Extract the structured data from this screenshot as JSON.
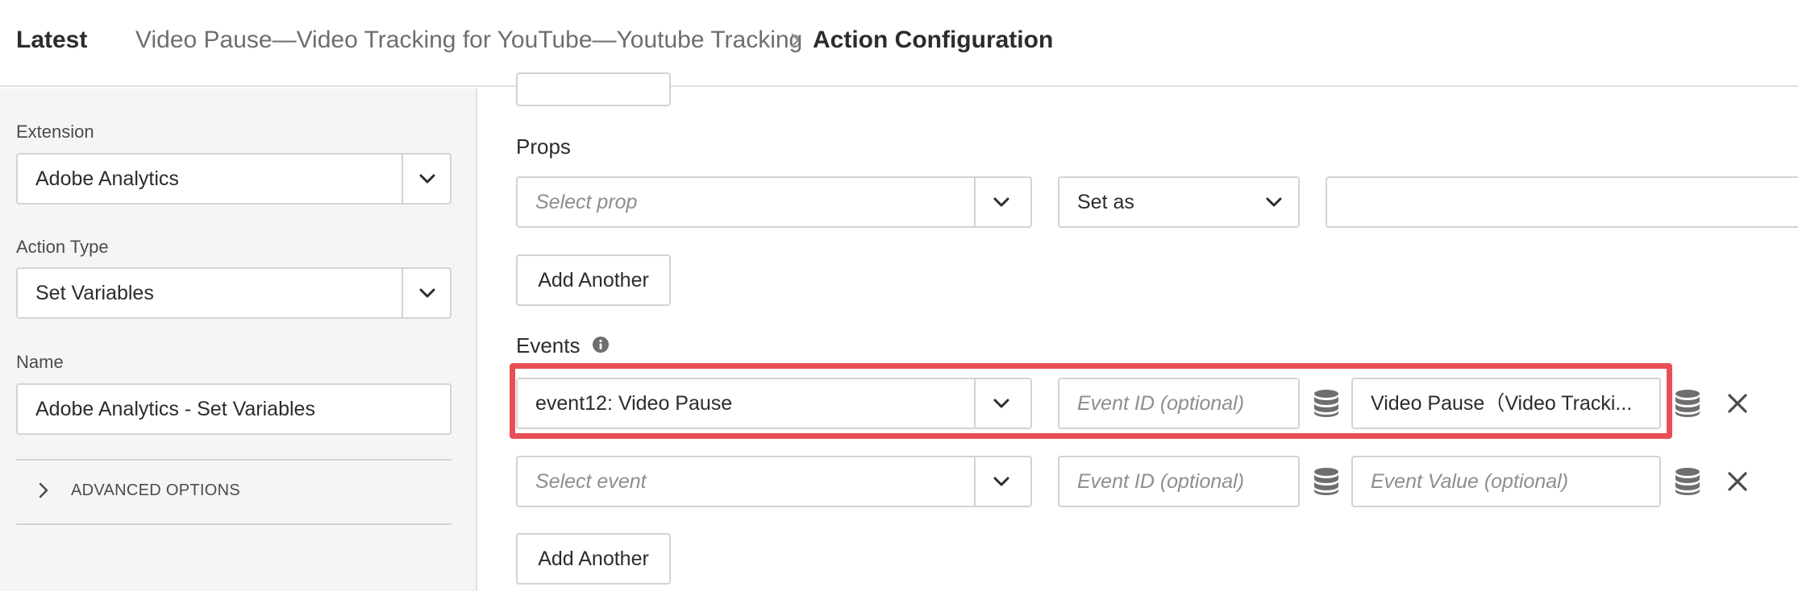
{
  "header": {
    "version_label": "Latest",
    "breadcrumb": "Video Pause—Video Tracking for YouTube—Youtube Tracking",
    "current_page": "Action Configuration"
  },
  "sidebar": {
    "extension": {
      "label": "Extension",
      "value": "Adobe Analytics"
    },
    "action_type": {
      "label": "Action Type",
      "value": "Set Variables"
    },
    "name": {
      "label": "Name",
      "value": "Adobe Analytics - Set Variables"
    },
    "advanced_options_label": "ADVANCED OPTIONS"
  },
  "props": {
    "section_label": "Props",
    "prop_select_placeholder": "Select prop",
    "set_as_value": "Set as",
    "value_input": "",
    "add_another_label": "Add Another"
  },
  "events": {
    "section_label": "Events",
    "rows": [
      {
        "event": "event12: Video Pause",
        "event_id_placeholder": "Event ID (optional)",
        "event_value": "Video Pause（Video Tracki..."
      },
      {
        "event_placeholder": "Select event",
        "event_id_placeholder": "Event ID (optional)",
        "event_value_placeholder": "Event Value (optional)"
      }
    ],
    "add_another_label": "Add Another"
  },
  "colors": {
    "highlight": "#e84e53",
    "sidebar_bg": "#f5f5f5",
    "border": "#d3d3d3"
  }
}
